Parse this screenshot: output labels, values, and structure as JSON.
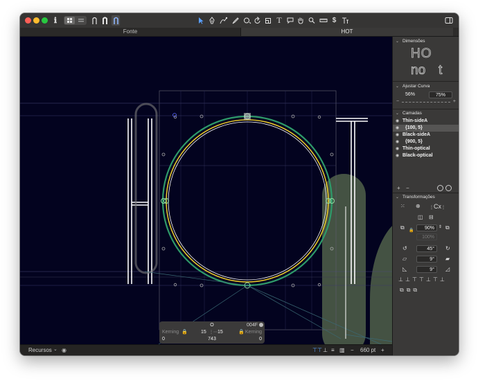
{
  "toolbar": {
    "info_icon": "ℹ",
    "view_buttons": [
      "grid-view",
      "list-view"
    ],
    "glyph_tabs": [
      "∩",
      "∩",
      "∩"
    ],
    "tools": [
      "pointer-icon",
      "pen-icon",
      "draw-icon",
      "brush-icon",
      "shape-icon",
      "rotate-icon",
      "scale-icon",
      "text-icon",
      "comment-icon",
      "hand-icon",
      "zoom-icon",
      "measure-icon",
      "dollar-icon",
      "text-style-icon"
    ],
    "text_tool_glyph": "T",
    "dollar_glyph": "$"
  },
  "tabs": [
    {
      "label": "Fonte"
    },
    {
      "label": "HOT"
    }
  ],
  "canvas": {
    "text_layer": "HOT",
    "metrics": {
      "char": "O",
      "code": "004F",
      "kerning_left_label": "Kerning",
      "left_sb": "15",
      "right_sb": "15",
      "kerning_right_label": "Kerning",
      "left_value": "0",
      "width": "743",
      "right_value": "0"
    }
  },
  "statusbar": {
    "resources_label": "Recursos",
    "zoom": "660 pt",
    "minus": "−",
    "plus": "+"
  },
  "sidebar": {
    "dimensions": {
      "title": "Dimensões",
      "preview_upper": "HO",
      "preview_lower_left": "no",
      "preview_lower_right": "t"
    },
    "curve": {
      "title": "Ajustar Curva",
      "value_1": "56%",
      "value_2": "75%",
      "minus": "−",
      "plus": "+"
    },
    "layers": {
      "title": "Camadas",
      "items": [
        {
          "label": "Thin-sideA",
          "selected": false
        },
        {
          "label": "{100, 5}",
          "selected": true
        },
        {
          "label": "Black-sideA",
          "selected": false
        },
        {
          "label": "{900, 5}",
          "selected": false
        },
        {
          "label": "Thin-optical",
          "selected": false
        },
        {
          "label": "Black-optical",
          "selected": false
        }
      ],
      "add": "+",
      "remove": "−"
    },
    "transforms": {
      "title": "Transformações",
      "scale": "90%",
      "scale_secondary": "100%",
      "rotate": "45°",
      "slant_1": "9°",
      "slant_2": "9°",
      "origin_label": "Cx"
    }
  },
  "colors": {
    "canvas_bg": "#03031f",
    "outline_white": "#ffffff",
    "outline_yellow": "#e5c52b",
    "outline_green": "#2e9a6a",
    "background_glyph": "#4a5a45"
  }
}
